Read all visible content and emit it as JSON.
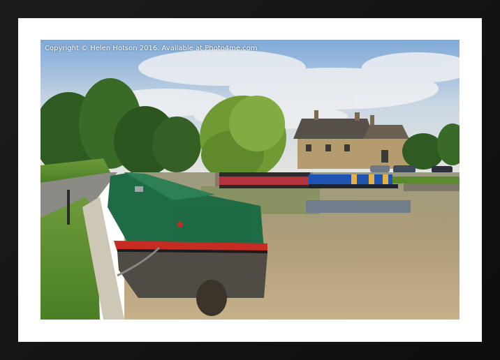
{
  "watermark": {
    "text": "Copyright  © Helen Hotson  2016. Available at Photo4me.com"
  },
  "colors": {
    "frame": "#111111",
    "mount": "#ffffff",
    "sky": "#9fc3e6",
    "water": "#a99a72",
    "boat_green": "#1f6b45",
    "boat_red": "#c62b24",
    "boat_blue": "#1e55b5"
  }
}
